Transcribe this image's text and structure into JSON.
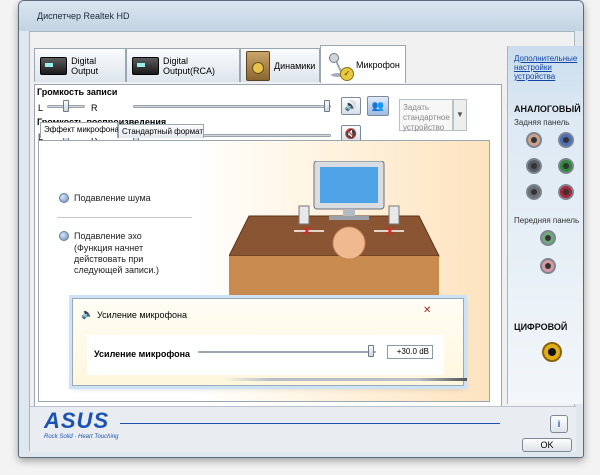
{
  "window": {
    "title": "Диспетчер Realtek HD"
  },
  "tabs": [
    {
      "label": "Digital Output",
      "icon": "digital-output-device-icon"
    },
    {
      "label": "Digital Output(RCA)",
      "icon": "digital-output-rca-device-icon"
    },
    {
      "label": "Динамики",
      "icon": "speakers-icon"
    },
    {
      "label": "Микрофон",
      "icon": "microphone-icon",
      "active": true
    }
  ],
  "recording": {
    "label": "Громкость записи",
    "left": "L",
    "right": "R",
    "balance": 0.5,
    "volume": 1.0
  },
  "playback": {
    "label": "Громкость воспроизведения",
    "left": "L",
    "right": "R",
    "balance": 0.5,
    "volume": 0.0
  },
  "default_device": {
    "label": "Задать стандартное устройство"
  },
  "inner_tabs": [
    {
      "label": "Эффект микрофона",
      "active": true
    },
    {
      "label": "Стандартный формат"
    }
  ],
  "effects": {
    "noise_suppression": "Подавление шума",
    "echo_suppression_title": "Подавление эхо",
    "echo_suppression_note": "(Функция начнет действовать при следующей записи.)"
  },
  "boost_popup": {
    "title": "Усиление микрофона",
    "label": "Усиление микрофона",
    "value_text": "+30.0 dB",
    "level": 1.0
  },
  "right_panel": {
    "link": "Дополнительные настройки устройства",
    "analog": "АНАЛОГОВЫЙ",
    "rear_panel": "Задняя панель",
    "front_panel": "Передняя панель",
    "digital": "ЦИФРОВОЙ",
    "rear_jacks": [
      "#c9a089",
      "#4a6fb5",
      "#555c64",
      "#2e8a3a",
      "#6a6f75",
      "#a8243a"
    ],
    "front_jacks": [
      "#6fa87b",
      "#d79aa3"
    ]
  },
  "brand": {
    "logo": "ASUS",
    "tagline": "Rock Solid · Heart Touching"
  },
  "buttons": {
    "ok": "OK",
    "info": "i"
  },
  "colors": {
    "accent": "#1c53b0",
    "link": "#1245a8",
    "popup_border": "#cbe3f5"
  }
}
